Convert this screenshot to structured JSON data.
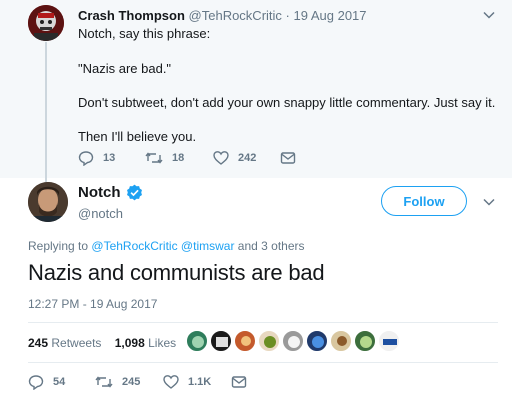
{
  "quoted_tweet": {
    "author_name": "Crash Thompson",
    "author_handle": "@TehRockCritic",
    "date": "· 19 Aug 2017",
    "lines": [
      "Notch, say this phrase:",
      "\"Nazis are bad.\"",
      "Don't subtweet, don't add your own snappy little commentary. Just say it.",
      "Then I'll believe you."
    ],
    "reply_count": "13",
    "retweet_count": "18",
    "like_count": "242"
  },
  "main_tweet": {
    "author_name": "Notch",
    "author_handle": "@notch",
    "follow_label": "Follow",
    "replying_prefix": "Replying to",
    "replying_handles": "@TehRockCritic @timswar",
    "replying_suffix": "and 3 others",
    "text": "Nazis and communists are bad",
    "timestamp": "12:27 PM - 19 Aug 2017",
    "retweets_count": "245",
    "retweets_label": "Retweets",
    "likes_count": "1,098",
    "likes_label": "Likes",
    "reply_count": "54",
    "retweet_count": "245",
    "like_count": "1.1K"
  },
  "colors": {
    "accent": "#1da1f2",
    "muted": "#657786",
    "quoted_background": "#f5f8fa"
  },
  "icons": {
    "reply": "reply-icon",
    "retweet": "retweet-icon",
    "like": "heart-icon",
    "message": "envelope-icon",
    "verified": "verified-badge-icon",
    "more": "chevron-down-icon"
  }
}
